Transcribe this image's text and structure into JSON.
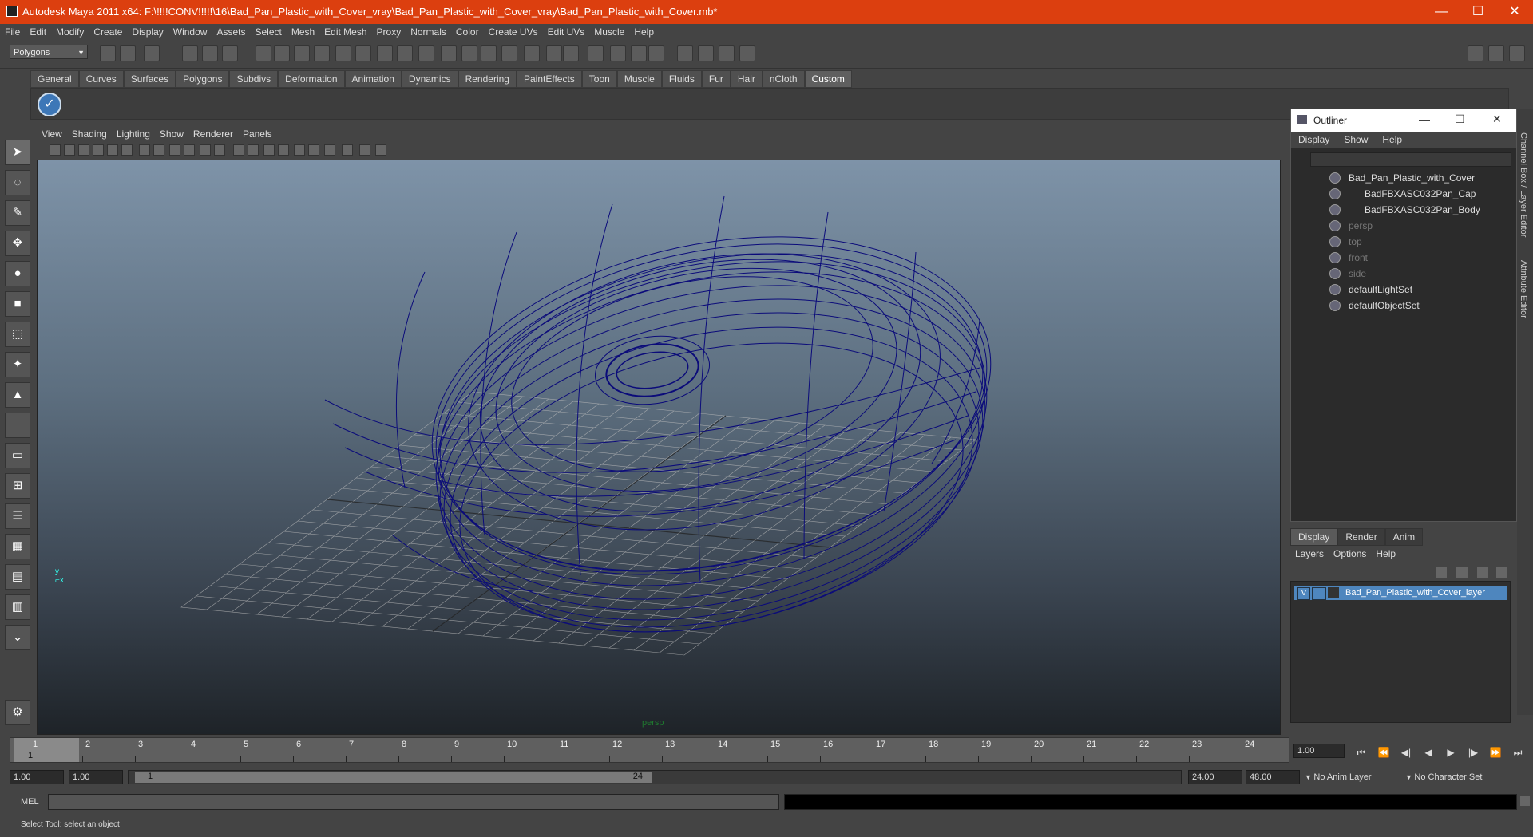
{
  "window": {
    "title": "Autodesk Maya 2011 x64: F:\\!!!!CONV!!!!!\\16\\Bad_Pan_Plastic_with_Cover_vray\\Bad_Pan_Plastic_with_Cover_vray\\Bad_Pan_Plastic_with_Cover.mb*",
    "minimize": "—",
    "maximize": "☐",
    "close": "✕"
  },
  "menu": [
    "File",
    "Edit",
    "Modify",
    "Create",
    "Display",
    "Window",
    "Assets",
    "Select",
    "Mesh",
    "Edit Mesh",
    "Proxy",
    "Normals",
    "Color",
    "Create UVs",
    "Edit UVs",
    "Muscle",
    "Help"
  ],
  "status": {
    "mode": "Polygons"
  },
  "shelf": {
    "tabs": [
      "General",
      "Curves",
      "Surfaces",
      "Polygons",
      "Subdivs",
      "Deformation",
      "Animation",
      "Dynamics",
      "Rendering",
      "PaintEffects",
      "Toon",
      "Muscle",
      "Fluids",
      "Fur",
      "Hair",
      "nCloth",
      "Custom"
    ],
    "active": "Custom"
  },
  "panel": {
    "menu": [
      "View",
      "Shading",
      "Lighting",
      "Show",
      "Renderer",
      "Panels"
    ],
    "camera": "persp"
  },
  "outliner": {
    "title": "Outliner",
    "menu": [
      "Display",
      "Show",
      "Help"
    ],
    "items": [
      {
        "label": "Bad_Pan_Plastic_with_Cover",
        "dim": false,
        "indent": 0
      },
      {
        "label": "BadFBXASC032Pan_Cap",
        "dim": false,
        "indent": 1
      },
      {
        "label": "BadFBXASC032Pan_Body",
        "dim": false,
        "indent": 1
      },
      {
        "label": "persp",
        "dim": true,
        "indent": 0
      },
      {
        "label": "top",
        "dim": true,
        "indent": 0
      },
      {
        "label": "front",
        "dim": true,
        "indent": 0
      },
      {
        "label": "side",
        "dim": true,
        "indent": 0
      },
      {
        "label": "defaultLightSet",
        "dim": false,
        "indent": 0
      },
      {
        "label": "defaultObjectSet",
        "dim": false,
        "indent": 0
      }
    ]
  },
  "side_tabs": [
    "Channel Box / Layer Editor",
    "Attribute Editor"
  ],
  "layer_editor": {
    "tabs": [
      "Display",
      "Render",
      "Anim"
    ],
    "active": "Display",
    "menu": [
      "Layers",
      "Options",
      "Help"
    ],
    "layer": {
      "visible": "V",
      "name": "Bad_Pan_Plastic_with_Cover_layer"
    }
  },
  "time": {
    "ticks": [
      "1",
      "2",
      "3",
      "4",
      "5",
      "6",
      "7",
      "8",
      "9",
      "10",
      "11",
      "12",
      "13",
      "14",
      "15",
      "16",
      "17",
      "18",
      "19",
      "20",
      "21",
      "22",
      "23",
      "24"
    ],
    "current_frame": "1",
    "current_field": "1.00",
    "range_start_outer": "1.00",
    "range_start_inner": "1.00",
    "range_slider_start": "1",
    "range_slider_end": "24",
    "range_end_inner": "24.00",
    "range_end_outer": "48.00",
    "anim_layer": "No Anim Layer",
    "character_set": "No Character Set"
  },
  "command": {
    "label": "MEL"
  },
  "help_line": "Select Tool: select an object",
  "colors": {
    "titlebar": "#dc3f0f",
    "wireframe": "#0b0b7a",
    "layer_highlight": "#4e86be",
    "camera_label": "#1f7a2f"
  }
}
